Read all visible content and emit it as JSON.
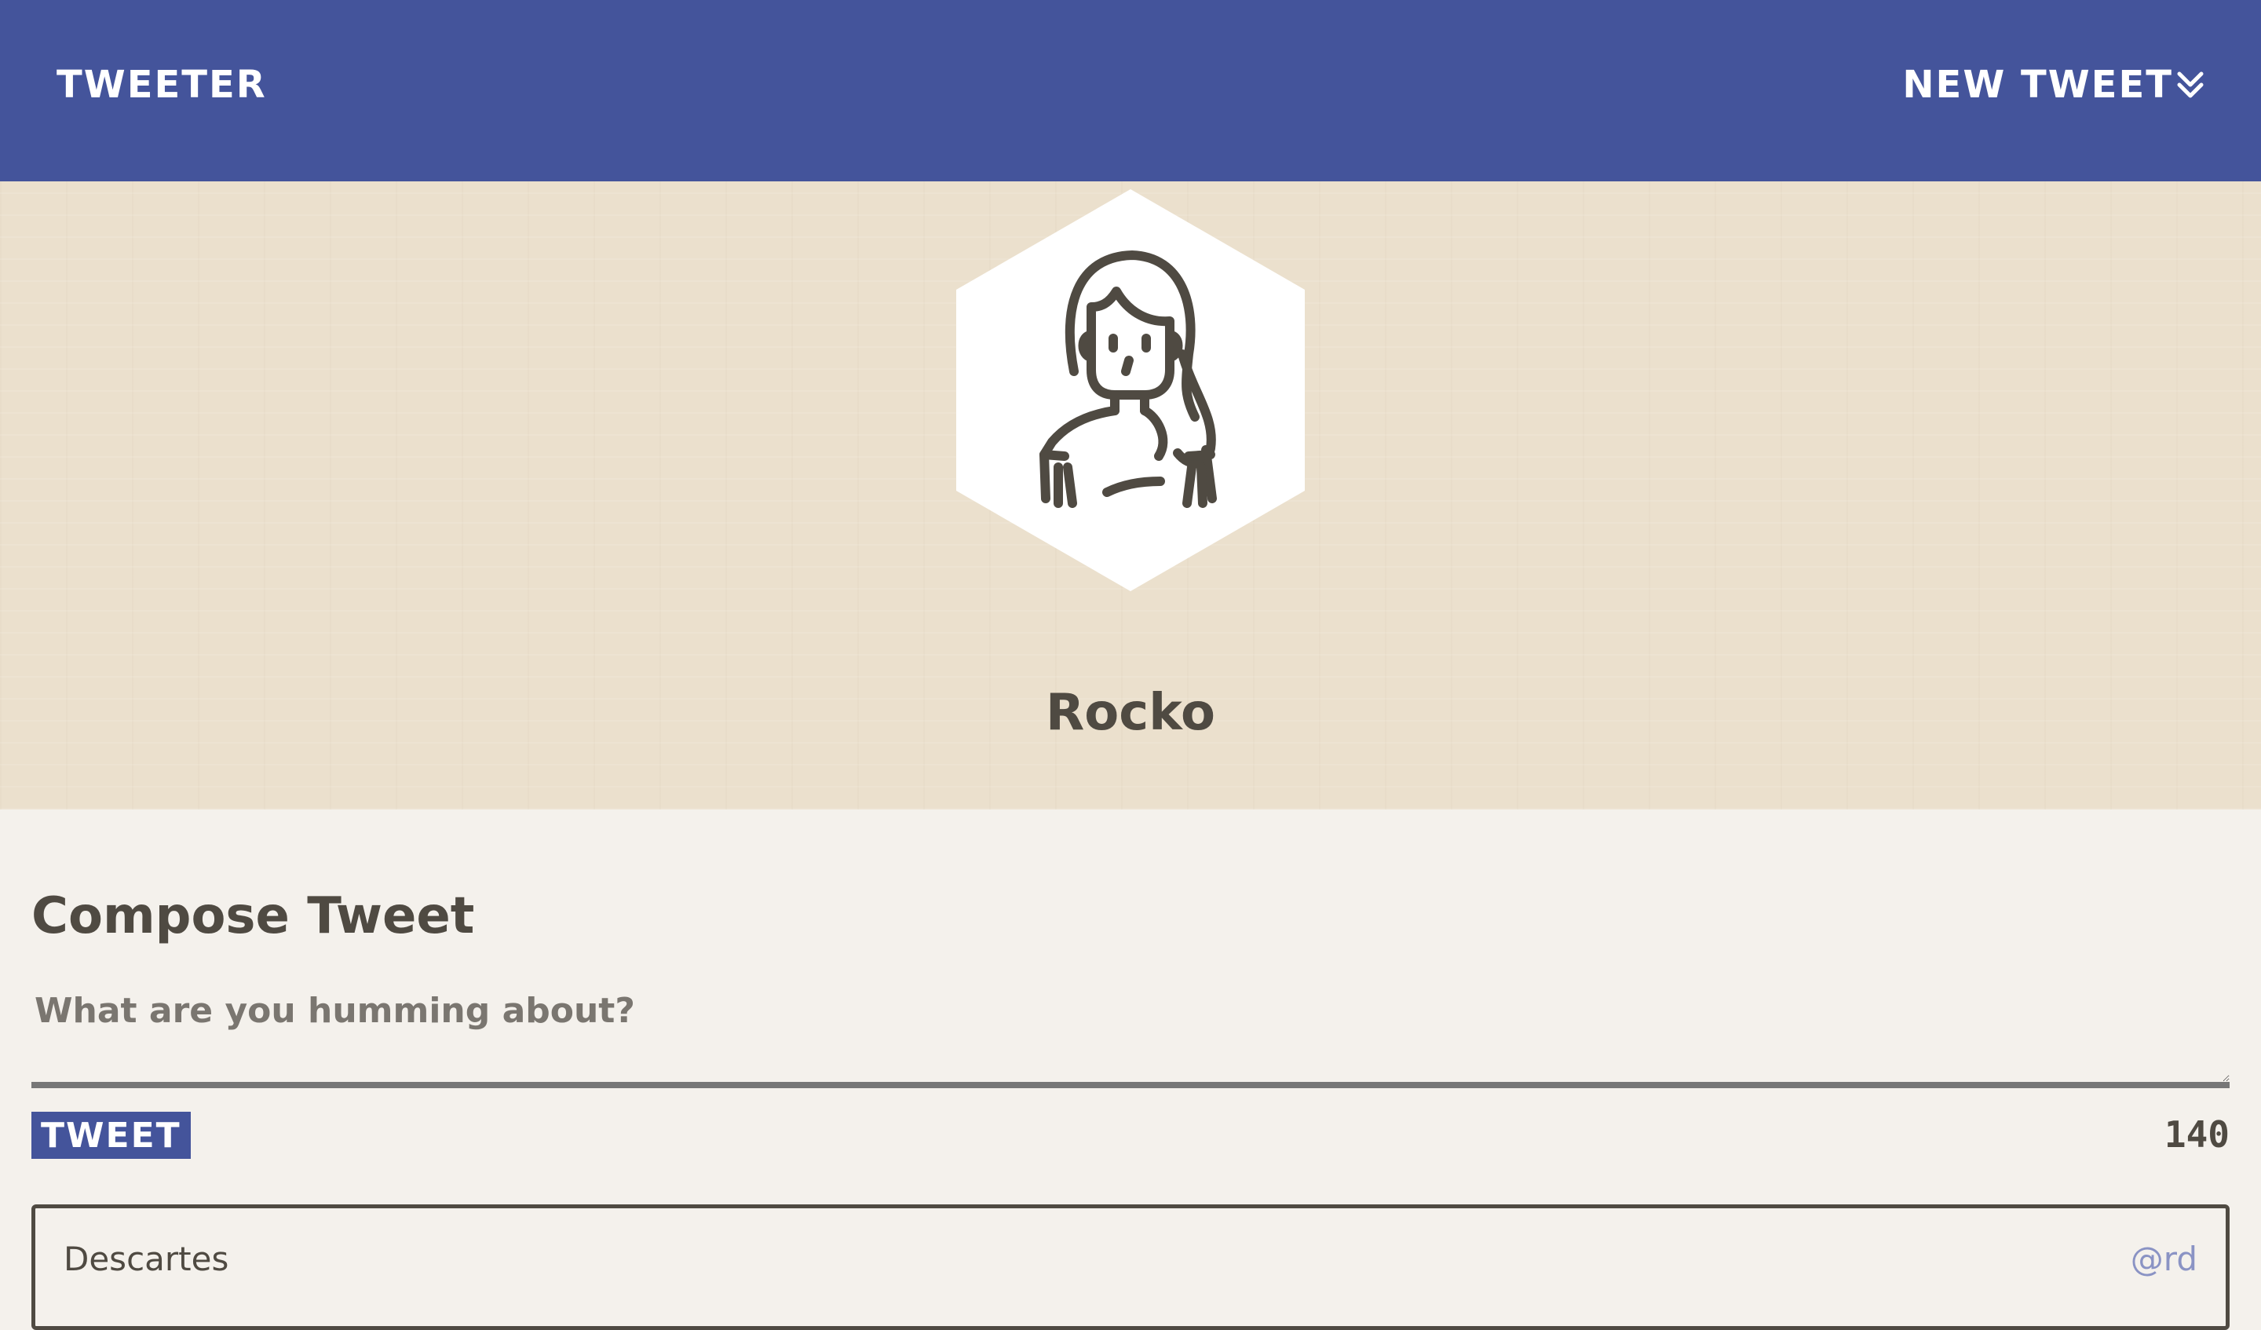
{
  "nav": {
    "brand": "Tweeter",
    "new_tweet_label": "New Tweet",
    "new_tweet_icon": "double-chevron-down-icon"
  },
  "profile": {
    "name": "Rocko",
    "avatar_icon": "woman-avatar-icon"
  },
  "compose": {
    "title": "Compose Tweet",
    "placeholder": "What are you humming about?",
    "value": "",
    "submit_label": "Tweet",
    "char_count": "140"
  },
  "tweets": [
    {
      "author": "Descartes",
      "handle": "@rd"
    }
  ],
  "colors": {
    "nav_bg": "#44549b",
    "header_bg": "#ebe0cd",
    "page_bg": "#f4f1ec",
    "text": "#4f4a42",
    "handle": "#8a93c4"
  }
}
